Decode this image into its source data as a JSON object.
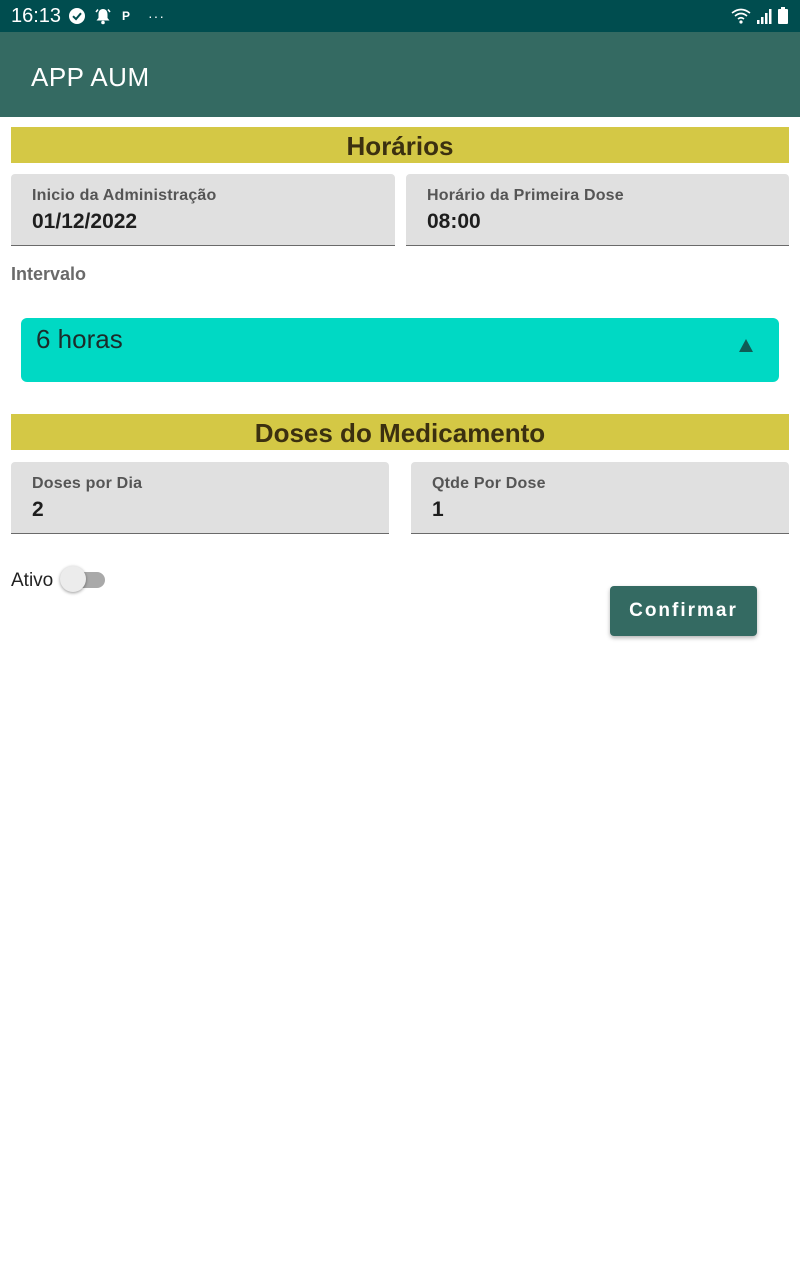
{
  "status_bar": {
    "time": "16:13",
    "notification_letter": "P",
    "more_dots": "···"
  },
  "app_bar": {
    "title": "APP AUM"
  },
  "horarios": {
    "header": "Horários",
    "inicio": {
      "label": "Inicio da Administração",
      "value": "01/12/2022"
    },
    "primeira_dose": {
      "label": "Horário da Primeira Dose",
      "value": "08:00"
    }
  },
  "intervalo": {
    "label": "Intervalo",
    "selected": "6 horas"
  },
  "doses": {
    "header": "Doses do Medicamento",
    "por_dia": {
      "label": "Doses por Dia",
      "value": "2"
    },
    "qtde_por_dose": {
      "label": "Qtde Por Dose",
      "value": "1"
    }
  },
  "ativo": {
    "label": "Ativo",
    "checked": false
  },
  "confirm_label": "Confirmar",
  "colors": {
    "status_bar": "#004d4f",
    "app_bar": "#346a62",
    "section_header": "#d4c845",
    "dropdown": "#00d9c4",
    "button": "#346a62"
  }
}
